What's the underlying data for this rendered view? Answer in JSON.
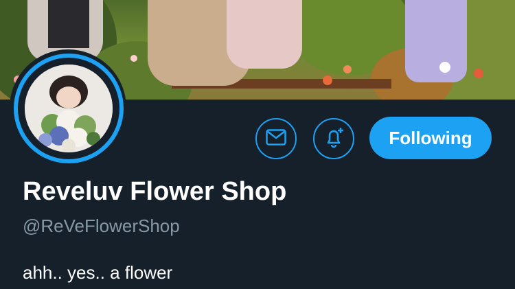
{
  "profile": {
    "display_name": "Reveluv Flower Shop",
    "handle": "@ReVeFlowerShop",
    "bio": "ahh.. yes.. a flower"
  },
  "actions": {
    "message_icon": "mail-icon",
    "notifications_icon": "bell-plus-icon",
    "following_label": "Following"
  },
  "colors": {
    "background": "#15202b",
    "accent": "#1da1f2",
    "secondary_text": "#8899a6",
    "primary_text": "#ffffff"
  }
}
